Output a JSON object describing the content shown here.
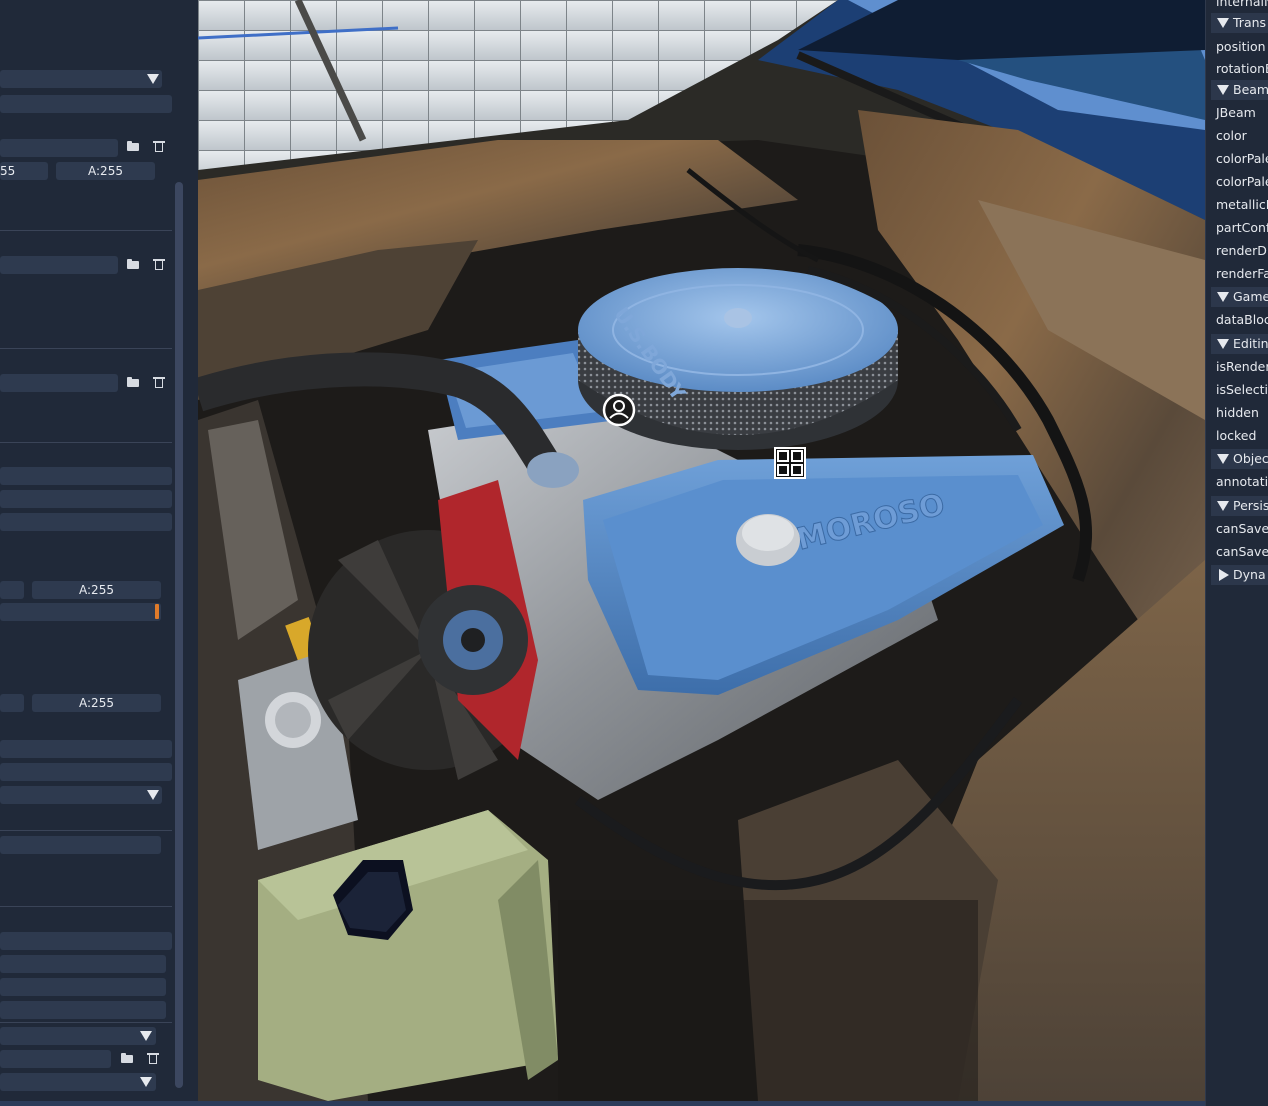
{
  "left_panel": {
    "channel_a_label": "A:255",
    "partial_value": "55",
    "icons": [
      "folder-icon",
      "trash-icon"
    ]
  },
  "right_panel": {
    "truncated_top": "internalN",
    "items": [
      {
        "type": "header",
        "label": "Trans",
        "expanded": true
      },
      {
        "type": "row",
        "label": "position"
      },
      {
        "type": "row",
        "label": "rotationE"
      },
      {
        "type": "header",
        "label": "Beam",
        "expanded": true
      },
      {
        "type": "row",
        "label": "JBeam"
      },
      {
        "type": "row",
        "label": "color"
      },
      {
        "type": "row",
        "label": "colorPale"
      },
      {
        "type": "row",
        "label": "colorPale"
      },
      {
        "type": "row",
        "label": "metallicP"
      },
      {
        "type": "row",
        "label": "partConfi"
      },
      {
        "type": "row",
        "label": "renderDis"
      },
      {
        "type": "row",
        "label": "renderFac"
      },
      {
        "type": "header",
        "label": "Game",
        "expanded": true
      },
      {
        "type": "row",
        "label": "dataBlock"
      },
      {
        "type": "header",
        "label": "Editin",
        "expanded": true
      },
      {
        "type": "row",
        "label": "isRenderE"
      },
      {
        "type": "row",
        "label": "isSelectio"
      },
      {
        "type": "row",
        "label": "hidden"
      },
      {
        "type": "row",
        "label": "locked"
      },
      {
        "type": "header",
        "label": "Objec",
        "expanded": true
      },
      {
        "type": "row",
        "label": "annotatio"
      },
      {
        "type": "header",
        "label": "Persis",
        "expanded": true
      },
      {
        "type": "row",
        "label": "canSave"
      },
      {
        "type": "row",
        "label": "canSaveD"
      },
      {
        "type": "header",
        "label": "Dyna",
        "expanded": false
      }
    ]
  },
  "viewport": {
    "valve_cover_text": "MOROSO",
    "air_cleaner_text": "U.S.BODY",
    "gizmos": [
      "object-origin-icon",
      "grid-snap-icon"
    ]
  },
  "colors": {
    "panel_bg": "#202939",
    "field_bg": "#2e3a4f",
    "accent_orange": "#e07b2a",
    "engine_blue": "#4e86c8"
  }
}
